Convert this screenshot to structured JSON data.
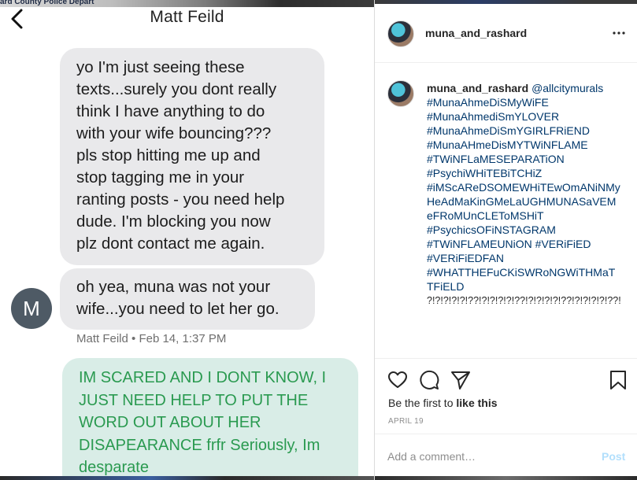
{
  "sms": {
    "background_text": "ard County Police Depart",
    "contact_name": "Matt Feild",
    "messages": [
      {
        "from": "them",
        "text": "yo I'm just seeing these\ntexts...surely you dont really\nthink I have anything to do\nwith your wife bouncing???\npls stop hitting me up and\nstop tagging me in your\nranting posts - you need help\ndude. I'm blocking you now\nplz dont contact me again."
      },
      {
        "from": "them",
        "text": "oh yea, muna was not your\nwife...you need to let her go."
      },
      {
        "from": "me",
        "text": "IM SCARED AND I DONT KNOW, I\nJUST NEED HELP TO PUT THE\nWORD OUT ABOUT HER\nDISAPEARANCE frfr Seriously, Im\ndesparate"
      }
    ],
    "avatar_initial": "M",
    "sender_meta": "Matt Feild • Feb 14, 1:37 PM",
    "colors": {
      "incoming_bubble": "#e9e9eb",
      "outgoing_bubble": "#d9ede7",
      "outgoing_text": "#2a9a50"
    }
  },
  "instagram": {
    "username": "muna_and_rashard",
    "more_icon": "more-horizontal-icon",
    "caption": {
      "username": "muna_and_rashard",
      "mention": "@allcitymurals",
      "hashtags": [
        "#MunaAhmeDiSMyWiFE",
        "#MunaAhmediSmYLOVER",
        "#MunaAhmeDiSmYGIRLFRiEND",
        "#MunaAHmeDisMYTWiNFLAME",
        "#TWiNFLaMESEPARATiON",
        "#PsychiWHiTEBiTCHiZ",
        "#iMScAReDSOMEWHiTEwOmANiNMyHeAdMaKinGMeLaUGHMUNASaVEMeFRoMUnCLEToMSHiT",
        "#PsychicsOFiNSTAGRAM",
        "#TWiNFLAMEUNiON #VERiFiED",
        "#VERiFiEDFAN",
        "#WHATTHEFuCKiSWRoNGWiTHMaTTFiELD"
      ],
      "question_marks": "?!?!?!?!?!??!?!?!?!?!??!?!?!?!?!??!?!?!?!?!??!?!?!?!?!??!?!?!?!?!??!?!?!?!?!??!?!?!?!?!??!?!?!?!?!??!?!?!?!?!??!?!?!?!?!??!?!?!?!?!??!?!?!?!?!??!?!?!?!?!??!?!?!?!?!??!?!?!?!?!??!?!?!?!?!??!?!?!?!?!??!?!?!?!?!??!?!?!?!?!??!?!?!?!?!??!"
    },
    "likes_prefix": "Be the first to ",
    "likes_action": "like this",
    "date": "APRIL 19",
    "comment_placeholder": "Add a comment…",
    "post_label": "Post",
    "colors": {
      "link": "#00376b",
      "post_button": "#b2dffc",
      "muted": "#8e8e8e"
    }
  }
}
